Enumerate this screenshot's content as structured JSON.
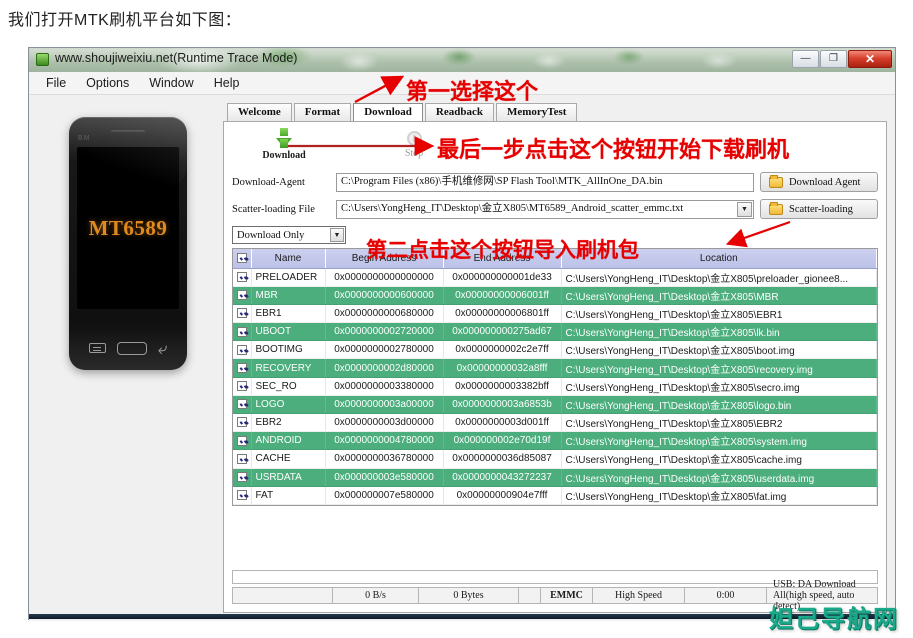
{
  "intro_text": "我们打开MTK刷机平台如下图：",
  "window": {
    "title": "www.shoujiweixiu.net(Runtime Trace Mode)",
    "icon": "app-icon",
    "controls": {
      "minimize": "—",
      "maximize": "❐",
      "close": "✕"
    }
  },
  "menubar": {
    "items": [
      "File",
      "Options",
      "Window",
      "Help"
    ]
  },
  "phone": {
    "brand": "BM",
    "chip_label": "MT6589"
  },
  "tabs": [
    {
      "label": "Welcome",
      "active": false
    },
    {
      "label": "Format",
      "active": false
    },
    {
      "label": "Download",
      "active": true
    },
    {
      "label": "Readback",
      "active": false
    },
    {
      "label": "MemoryTest",
      "active": false
    }
  ],
  "toolbar": {
    "download_label": "Download",
    "stop_label": "Stop"
  },
  "form": {
    "agent_label": "Download-Agent",
    "agent_value": "C:\\Program Files (x86)\\手机维修网\\SP Flash Tool\\MTK_AllInOne_DA.bin",
    "agent_button": "Download Agent",
    "scatter_label": "Scatter-loading File",
    "scatter_value": "C:\\Users\\YongHeng_IT\\Desktop\\金立X805\\MT6589_Android_scatter_emmc.txt",
    "scatter_button": "Scatter-loading",
    "mode_value": "Download Only"
  },
  "table": {
    "headers": [
      "",
      "Name",
      "Begin Address",
      "End Address",
      "Location"
    ],
    "rows": [
      {
        "checked": true,
        "name": "PRELOADER",
        "begin": "0x0000000000000000",
        "end": "0x000000000001de33",
        "location": "C:\\Users\\YongHeng_IT\\Desktop\\金立X805\\preloader_gionee8...",
        "highlight": false
      },
      {
        "checked": true,
        "name": "MBR",
        "begin": "0x0000000000600000",
        "end": "0x00000000006001ff",
        "location": "C:\\Users\\YongHeng_IT\\Desktop\\金立X805\\MBR",
        "highlight": true
      },
      {
        "checked": true,
        "name": "EBR1",
        "begin": "0x0000000000680000",
        "end": "0x00000000006801ff",
        "location": "C:\\Users\\YongHeng_IT\\Desktop\\金立X805\\EBR1",
        "highlight": false
      },
      {
        "checked": true,
        "name": "UBOOT",
        "begin": "0x0000000002720000",
        "end": "0x000000000275ad67",
        "location": "C:\\Users\\YongHeng_IT\\Desktop\\金立X805\\lk.bin",
        "highlight": true
      },
      {
        "checked": true,
        "name": "BOOTIMG",
        "begin": "0x0000000002780000",
        "end": "0x0000000002c2e7ff",
        "location": "C:\\Users\\YongHeng_IT\\Desktop\\金立X805\\boot.img",
        "highlight": false
      },
      {
        "checked": true,
        "name": "RECOVERY",
        "begin": "0x0000000002d80000",
        "end": "0x00000000032a8fff",
        "location": "C:\\Users\\YongHeng_IT\\Desktop\\金立X805\\recovery.img",
        "highlight": true
      },
      {
        "checked": true,
        "name": "SEC_RO",
        "begin": "0x0000000003380000",
        "end": "0x0000000003382bff",
        "location": "C:\\Users\\YongHeng_IT\\Desktop\\金立X805\\secro.img",
        "highlight": false
      },
      {
        "checked": true,
        "name": "LOGO",
        "begin": "0x0000000003a00000",
        "end": "0x0000000003a6853b",
        "location": "C:\\Users\\YongHeng_IT\\Desktop\\金立X805\\logo.bin",
        "highlight": true
      },
      {
        "checked": true,
        "name": "EBR2",
        "begin": "0x0000000003d00000",
        "end": "0x0000000003d001ff",
        "location": "C:\\Users\\YongHeng_IT\\Desktop\\金立X805\\EBR2",
        "highlight": false
      },
      {
        "checked": true,
        "name": "ANDROID",
        "begin": "0x0000000004780000",
        "end": "0x000000002e70d19f",
        "location": "C:\\Users\\YongHeng_IT\\Desktop\\金立X805\\system.img",
        "highlight": true
      },
      {
        "checked": true,
        "name": "CACHE",
        "begin": "0x0000000036780000",
        "end": "0x0000000036d85087",
        "location": "C:\\Users\\YongHeng_IT\\Desktop\\金立X805\\cache.img",
        "highlight": false
      },
      {
        "checked": true,
        "name": "USRDATA",
        "begin": "0x000000003e580000",
        "end": "0x0000000043272237",
        "location": "C:\\Users\\YongHeng_IT\\Desktop\\金立X805\\userdata.img",
        "highlight": true
      },
      {
        "checked": true,
        "name": "FAT",
        "begin": "0x000000007e580000",
        "end": "0x00000000904e7fff",
        "location": "C:\\Users\\YongHeng_IT\\Desktop\\金立X805\\fat.img",
        "highlight": false
      }
    ]
  },
  "statusbar": {
    "speed": "0 B/s",
    "bytes": "0 Bytes",
    "storage": "EMMC",
    "usb_speed": "High Speed",
    "elapsed": "0:00",
    "usb_info": "USB: DA Download All(high speed, auto detect)"
  },
  "annotations": {
    "first": "第一选择这个",
    "last": "最后一步点击这个按钮开始下载刷机",
    "second": "第二点击这个按钮导入刷机包"
  },
  "watermark": "妲己导航网",
  "colors": {
    "annotation_red": "#e60000",
    "row_highlight_green": "#4cad7d",
    "header_lavender": "#c6cbec",
    "watermark_teal": "#1aa98a",
    "chip_orange": "#e08a1e"
  }
}
